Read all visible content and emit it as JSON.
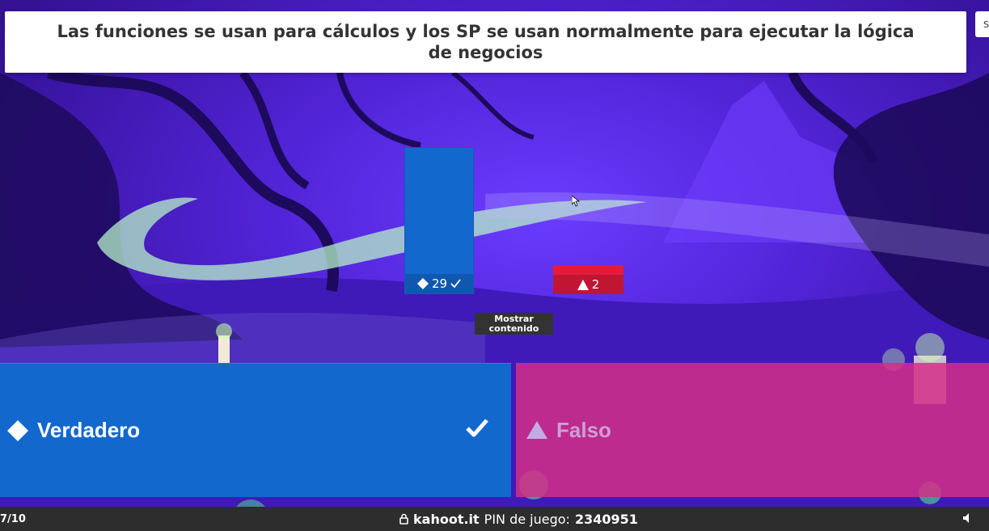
{
  "question": {
    "text": "Las funciones se usan para cálculos y los SP se usan normalmente para ejecutar la lógica de negocios"
  },
  "corner_button": {
    "label": "S"
  },
  "results": {
    "bars": [
      {
        "shape": "diamond",
        "count": "29",
        "correct": true,
        "color": "#1368ce",
        "height_ratio": 1.0
      },
      {
        "shape": "triangle",
        "count": "2",
        "correct": false,
        "color": "#e21b3c",
        "height_ratio": 0.2
      }
    ]
  },
  "show_content_button": {
    "label": "Mostrar contenido"
  },
  "answers": [
    {
      "shape": "diamond-icon",
      "label": "Verdadero",
      "color": "#1368ce",
      "correct": true
    },
    {
      "shape": "triangle-icon",
      "label": "Falso",
      "color": "#d42f87",
      "correct": false
    }
  ],
  "footer": {
    "progress": "7/10",
    "site": "kahoot.it",
    "pin_label": "PIN de juego:",
    "pin": "2340951",
    "icons": [
      "lock-icon",
      "speaker-icon"
    ]
  }
}
